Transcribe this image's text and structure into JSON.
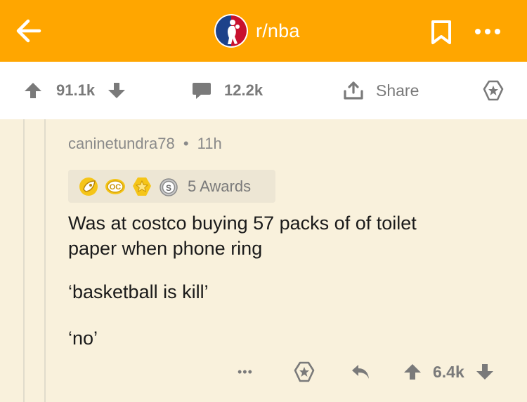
{
  "header": {
    "subreddit": "r/nba",
    "icons": [
      "back-arrow-icon",
      "nba-logo",
      "bookmark-icon",
      "more-dots-icon"
    ],
    "color": "#ffa600"
  },
  "post_actions": {
    "upvotes": "91.1k",
    "comments": "12.2k",
    "share_label": "Share"
  },
  "comment": {
    "author": "caninetundra78",
    "separator": "•",
    "age": "11h",
    "awards_label": "5 Awards",
    "lines": [
      "Was at costco buying 57 packs of of toilet",
      "paper when phone ring",
      "‘basketball is kill’",
      "‘no’"
    ],
    "more_label": "•••",
    "score": "6.4k"
  }
}
